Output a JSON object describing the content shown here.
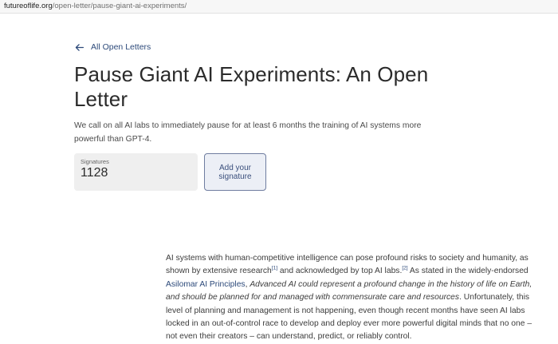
{
  "browser": {
    "url_host": "futureoflife.org",
    "url_path": "/open-letter/pause-giant-ai-experiments/"
  },
  "nav": {
    "back_label": "All Open Letters"
  },
  "page": {
    "title": "Pause Giant AI Experiments: An Open Letter",
    "intro": "We call on all AI labs to immediately pause for at least 6 months the training of AI systems more powerful than GPT-4."
  },
  "signatures": {
    "label": "Signatures",
    "count": "1128",
    "add_button": "Add your signature"
  },
  "letter": {
    "p1_a": "AI systems with human-competitive intelligence can pose profound risks to society and humanity, as shown by extensive research",
    "ref1": "[1]",
    "p1_b": " and acknowledged by top AI labs.",
    "ref2": "[2]",
    "p1_c": " As stated in the widely-endorsed ",
    "link": "Asilomar AI Principles",
    "p1_d": ", ",
    "quote": "Advanced AI could represent a profound change in the history of life on Earth, and should be planned for and managed with commensurate care and resources",
    "p1_e": ". Unfortunately, this level of planning and management is not happening, even though recent months have seen AI labs locked in an out-of-control race to develop and deploy ever more powerful digital minds that no one – not even their creators – can understand, predict, or reliably control."
  }
}
